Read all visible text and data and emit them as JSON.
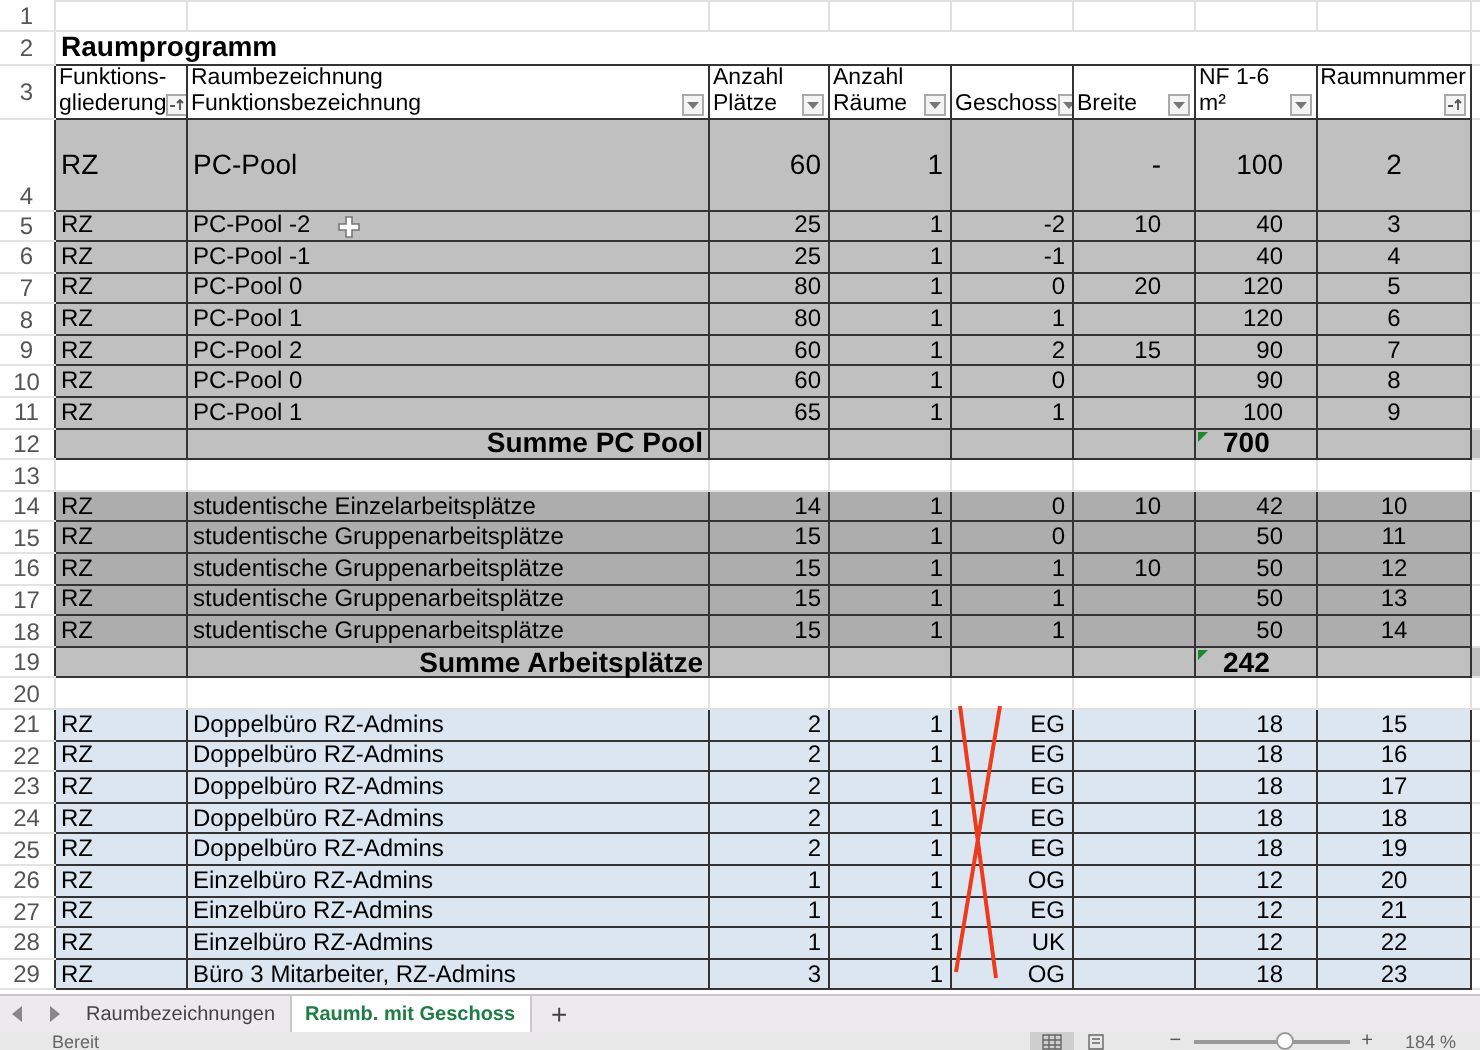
{
  "sheet": {
    "rows": [
      {
        "row": "1",
        "kind": "blank"
      },
      {
        "row": "2",
        "kind": "title",
        "text": "Raumprogramm"
      },
      {
        "row": "3",
        "kind": "header",
        "columns": [
          {
            "line1": "Funktions-",
            "line2": "gliederung",
            "sorted": true
          },
          {
            "line1": "Raumbezeichnung",
            "line2": "Funktionsbezeichnung",
            "sorted": false
          },
          {
            "line1": "Anzahl",
            "line2": "Plätze",
            "sorted": false
          },
          {
            "line1": "Anzahl",
            "line2": "Räume",
            "sorted": false
          },
          {
            "line2": "Geschoss",
            "sorted": false
          },
          {
            "line2": "Breite",
            "sorted": false
          },
          {
            "line1": "NF 1-6",
            "line2": "m²",
            "sorted": false
          },
          {
            "line1": "Raumnummer",
            "sorted": true,
            "centered": true
          }
        ]
      },
      {
        "row": "4",
        "kind": "main",
        "cells": [
          "RZ",
          "PC-Pool",
          "60",
          "1",
          null,
          "-",
          "100",
          "2"
        ]
      },
      {
        "row": "5",
        "kind": "pool",
        "cells": [
          "RZ",
          "PC-Pool -2",
          "25",
          "1",
          "-2",
          "10",
          "40",
          "3"
        ],
        "cursor": true
      },
      {
        "row": "6",
        "kind": "pool",
        "cells": [
          "RZ",
          "PC-Pool -1",
          "25",
          "1",
          "-1",
          null,
          "40",
          "4"
        ]
      },
      {
        "row": "7",
        "kind": "pool",
        "cells": [
          "RZ",
          "PC-Pool 0",
          "80",
          "1",
          "0",
          "20",
          "120",
          "5"
        ]
      },
      {
        "row": "8",
        "kind": "pool",
        "cells": [
          "RZ",
          "PC-Pool 1",
          "80",
          "1",
          "1",
          null,
          "120",
          "6"
        ]
      },
      {
        "row": "9",
        "kind": "pool",
        "cells": [
          "RZ",
          "PC-Pool 2",
          "60",
          "1",
          "2",
          "15",
          "90",
          "7"
        ]
      },
      {
        "row": "10",
        "kind": "pool",
        "cells": [
          "RZ",
          "PC-Pool 0",
          "60",
          "1",
          "0",
          null,
          "90",
          "8"
        ]
      },
      {
        "row": "11",
        "kind": "pool",
        "cells": [
          "RZ",
          "PC-Pool 1",
          "65",
          "1",
          "1",
          null,
          "100",
          "9"
        ]
      },
      {
        "row": "12",
        "kind": "sum",
        "label": "Summe PC Pool",
        "total": "700"
      },
      {
        "row": "13",
        "kind": "blank"
      },
      {
        "row": "14",
        "kind": "work",
        "cells": [
          "RZ",
          "studentische Einzelarbeitsplätze",
          "14",
          "1",
          "0",
          "10",
          "42",
          "10"
        ]
      },
      {
        "row": "15",
        "kind": "work",
        "cells": [
          "RZ",
          "studentische Gruppenarbeitsplätze",
          "15",
          "1",
          "0",
          null,
          "50",
          "11"
        ]
      },
      {
        "row": "16",
        "kind": "work",
        "cells": [
          "RZ",
          "studentische Gruppenarbeitsplätze",
          "15",
          "1",
          "1",
          "10",
          "50",
          "12"
        ]
      },
      {
        "row": "17",
        "kind": "work",
        "cells": [
          "RZ",
          "studentische Gruppenarbeitsplätze",
          "15",
          "1",
          "1",
          null,
          "50",
          "13"
        ]
      },
      {
        "row": "18",
        "kind": "work",
        "cells": [
          "RZ",
          "studentische Gruppenarbeitsplätze",
          "15",
          "1",
          "1",
          null,
          "50",
          "14"
        ]
      },
      {
        "row": "19",
        "kind": "sum",
        "label": "Summe Arbeitsplätze",
        "total": "242"
      },
      {
        "row": "20",
        "kind": "blank"
      },
      {
        "row": "21",
        "kind": "admin",
        "cells": [
          "RZ",
          "Doppelbüro RZ-Admins",
          "2",
          "1",
          "EG",
          null,
          "18",
          "15"
        ]
      },
      {
        "row": "22",
        "kind": "admin",
        "cells": [
          "RZ",
          "Doppelbüro RZ-Admins",
          "2",
          "1",
          "EG",
          null,
          "18",
          "16"
        ]
      },
      {
        "row": "23",
        "kind": "admin",
        "cells": [
          "RZ",
          "Doppelbüro RZ-Admins",
          "2",
          "1",
          "EG",
          null,
          "18",
          "17"
        ]
      },
      {
        "row": "24",
        "kind": "admin",
        "cells": [
          "RZ",
          "Doppelbüro RZ-Admins",
          "2",
          "1",
          "EG",
          null,
          "18",
          "18"
        ]
      },
      {
        "row": "25",
        "kind": "admin",
        "cells": [
          "RZ",
          "Doppelbüro RZ-Admins",
          "2",
          "1",
          "EG",
          null,
          "18",
          "19"
        ]
      },
      {
        "row": "26",
        "kind": "admin",
        "cells": [
          "RZ",
          "Einzelbüro RZ-Admins",
          "1",
          "1",
          "OG",
          null,
          "12",
          "20"
        ]
      },
      {
        "row": "27",
        "kind": "admin",
        "cells": [
          "RZ",
          "Einzelbüro RZ-Admins",
          "1",
          "1",
          "EG",
          null,
          "12",
          "21"
        ]
      },
      {
        "row": "28",
        "kind": "admin",
        "cells": [
          "RZ",
          "Einzelbüro RZ-Admins",
          "1",
          "1",
          "UK",
          null,
          "12",
          "22"
        ]
      },
      {
        "row": "29",
        "kind": "admin",
        "cells": [
          "RZ",
          "Büro 3 Mitarbeiter, RZ-Admins",
          "3",
          "1",
          "OG",
          null,
          "18",
          "23"
        ]
      }
    ],
    "struck_column": true
  },
  "sheet_tabs": {
    "tabs": [
      {
        "label": "Raumbezeichnungen",
        "selected": false
      },
      {
        "label": "Raumb. mit Geschoss",
        "selected": true
      }
    ],
    "add_label": "+"
  },
  "status_bar": {
    "status": "Bereit",
    "zoom_minus": "−",
    "zoom_plus": "+",
    "zoom": {
      "level": 0.6,
      "reading": "184 %"
    }
  }
}
